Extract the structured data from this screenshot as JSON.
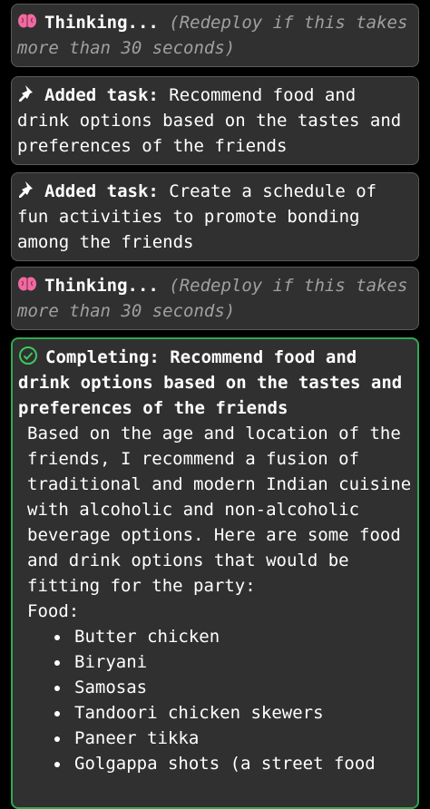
{
  "cards": [
    {
      "type": "thinking",
      "icon": "brain-icon",
      "label": "Thinking...",
      "note": "(Redeploy if this takes more than 30 seconds)"
    },
    {
      "type": "task",
      "icon": "pin-icon",
      "label": "Added task:",
      "text": "Recommend food and drink options based on the tastes and preferences of the friends"
    },
    {
      "type": "task",
      "icon": "pin-icon",
      "label": "Added task:",
      "text": "Create a schedule of fun activities to promote bonding among the friends"
    },
    {
      "type": "thinking",
      "icon": "brain-icon",
      "label": "Thinking...",
      "note": "(Redeploy if this takes more than 30 seconds)"
    },
    {
      "type": "completing",
      "icon": "check-circle-icon",
      "label": "Completing:",
      "title": "Recommend food and drink options based on the tastes and preferences of the friends",
      "body": "Based on the age and location of the friends, I recommend a fusion of traditional and modern Indian cuisine with alcoholic and non-alcoholic beverage options. Here are some food and drink options that would be fitting for the party:",
      "section": "Food:",
      "items": [
        "Butter chicken",
        "Biryani",
        "Samosas",
        "Tandoori chicken skewers",
        "Paneer tikka",
        "Golgappa shots (a street food"
      ]
    }
  ],
  "colors": {
    "card_bg": "#303030",
    "border": "#5a5a5a",
    "active_border": "#2fa84f",
    "brain": "#f06aa0",
    "check": "#3cc85e"
  }
}
